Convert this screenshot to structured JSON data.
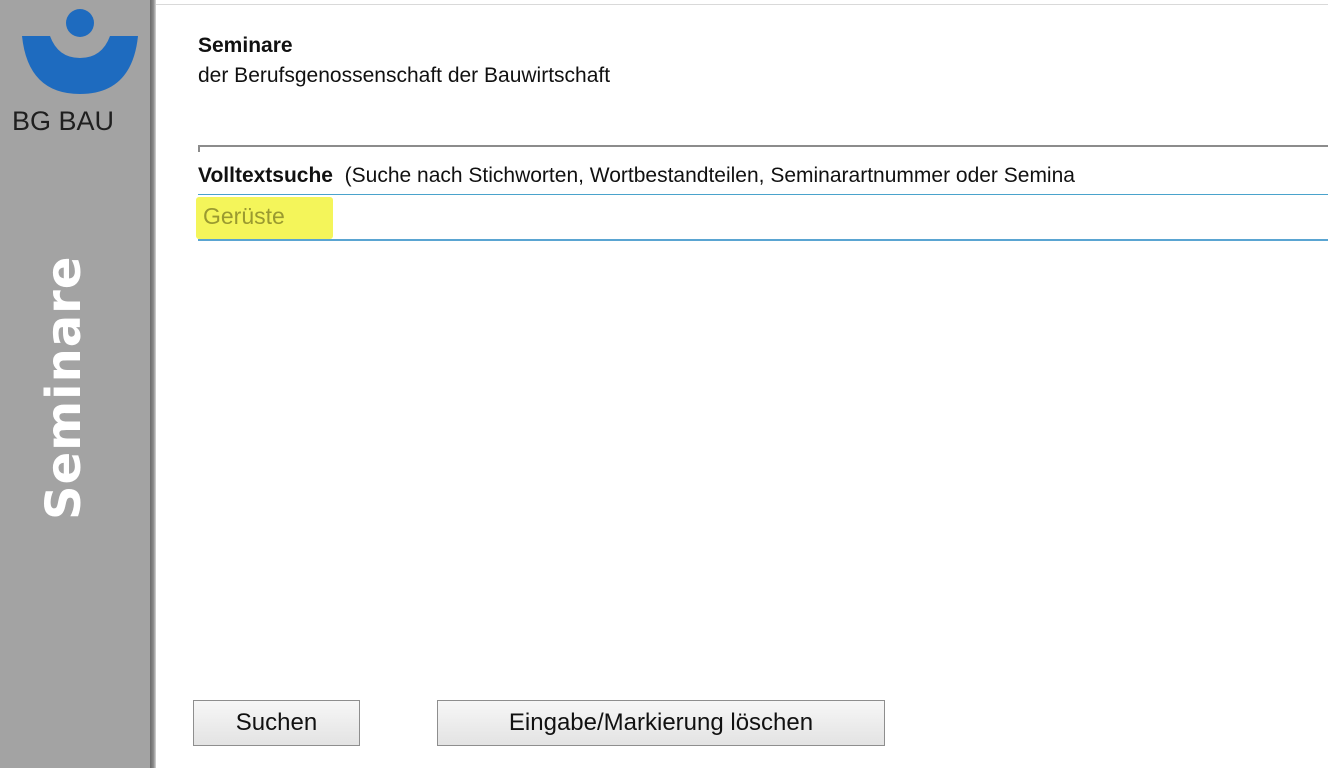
{
  "sidebar": {
    "logo_text": "BG BAU",
    "vertical_title": "Seminare",
    "logo_color": "#1e6bbf"
  },
  "header": {
    "title": "Seminare",
    "subtitle": "der Berufsgenossenschaft der Bauwirtschaft"
  },
  "search": {
    "label": "Volltextsuche",
    "hint": "(Suche nach Stichworten, Wortbestandteilen, Seminarartnummer oder Semina",
    "value": "Gerüste",
    "highlight_color": "#f4f55a",
    "underline_color": "#5aa5d2"
  },
  "buttons": {
    "search_label": "Suchen",
    "clear_label": "Eingabe/Markierung löschen"
  }
}
